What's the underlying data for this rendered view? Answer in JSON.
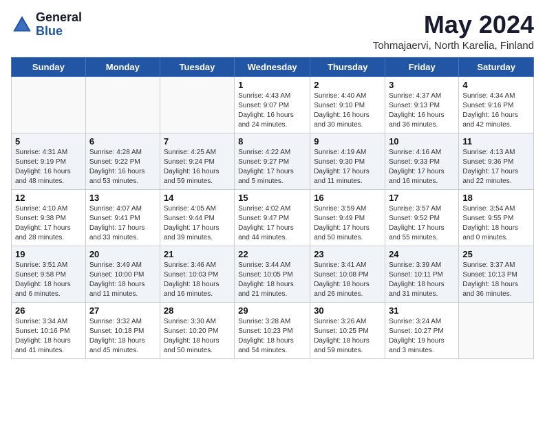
{
  "logo": {
    "general": "General",
    "blue": "Blue"
  },
  "title": "May 2024",
  "location": "Tohmajaervi, North Karelia, Finland",
  "days_of_week": [
    "Sunday",
    "Monday",
    "Tuesday",
    "Wednesday",
    "Thursday",
    "Friday",
    "Saturday"
  ],
  "weeks": [
    [
      {
        "day": "",
        "info": ""
      },
      {
        "day": "",
        "info": ""
      },
      {
        "day": "",
        "info": ""
      },
      {
        "day": "1",
        "info": "Sunrise: 4:43 AM\nSunset: 9:07 PM\nDaylight: 16 hours\nand 24 minutes."
      },
      {
        "day": "2",
        "info": "Sunrise: 4:40 AM\nSunset: 9:10 PM\nDaylight: 16 hours\nand 30 minutes."
      },
      {
        "day": "3",
        "info": "Sunrise: 4:37 AM\nSunset: 9:13 PM\nDaylight: 16 hours\nand 36 minutes."
      },
      {
        "day": "4",
        "info": "Sunrise: 4:34 AM\nSunset: 9:16 PM\nDaylight: 16 hours\nand 42 minutes."
      }
    ],
    [
      {
        "day": "5",
        "info": "Sunrise: 4:31 AM\nSunset: 9:19 PM\nDaylight: 16 hours\nand 48 minutes."
      },
      {
        "day": "6",
        "info": "Sunrise: 4:28 AM\nSunset: 9:22 PM\nDaylight: 16 hours\nand 53 minutes."
      },
      {
        "day": "7",
        "info": "Sunrise: 4:25 AM\nSunset: 9:24 PM\nDaylight: 16 hours\nand 59 minutes."
      },
      {
        "day": "8",
        "info": "Sunrise: 4:22 AM\nSunset: 9:27 PM\nDaylight: 17 hours\nand 5 minutes."
      },
      {
        "day": "9",
        "info": "Sunrise: 4:19 AM\nSunset: 9:30 PM\nDaylight: 17 hours\nand 11 minutes."
      },
      {
        "day": "10",
        "info": "Sunrise: 4:16 AM\nSunset: 9:33 PM\nDaylight: 17 hours\nand 16 minutes."
      },
      {
        "day": "11",
        "info": "Sunrise: 4:13 AM\nSunset: 9:36 PM\nDaylight: 17 hours\nand 22 minutes."
      }
    ],
    [
      {
        "day": "12",
        "info": "Sunrise: 4:10 AM\nSunset: 9:38 PM\nDaylight: 17 hours\nand 28 minutes."
      },
      {
        "day": "13",
        "info": "Sunrise: 4:07 AM\nSunset: 9:41 PM\nDaylight: 17 hours\nand 33 minutes."
      },
      {
        "day": "14",
        "info": "Sunrise: 4:05 AM\nSunset: 9:44 PM\nDaylight: 17 hours\nand 39 minutes."
      },
      {
        "day": "15",
        "info": "Sunrise: 4:02 AM\nSunset: 9:47 PM\nDaylight: 17 hours\nand 44 minutes."
      },
      {
        "day": "16",
        "info": "Sunrise: 3:59 AM\nSunset: 9:49 PM\nDaylight: 17 hours\nand 50 minutes."
      },
      {
        "day": "17",
        "info": "Sunrise: 3:57 AM\nSunset: 9:52 PM\nDaylight: 17 hours\nand 55 minutes."
      },
      {
        "day": "18",
        "info": "Sunrise: 3:54 AM\nSunset: 9:55 PM\nDaylight: 18 hours\nand 0 minutes."
      }
    ],
    [
      {
        "day": "19",
        "info": "Sunrise: 3:51 AM\nSunset: 9:58 PM\nDaylight: 18 hours\nand 6 minutes."
      },
      {
        "day": "20",
        "info": "Sunrise: 3:49 AM\nSunset: 10:00 PM\nDaylight: 18 hours\nand 11 minutes."
      },
      {
        "day": "21",
        "info": "Sunrise: 3:46 AM\nSunset: 10:03 PM\nDaylight: 18 hours\nand 16 minutes."
      },
      {
        "day": "22",
        "info": "Sunrise: 3:44 AM\nSunset: 10:05 PM\nDaylight: 18 hours\nand 21 minutes."
      },
      {
        "day": "23",
        "info": "Sunrise: 3:41 AM\nSunset: 10:08 PM\nDaylight: 18 hours\nand 26 minutes."
      },
      {
        "day": "24",
        "info": "Sunrise: 3:39 AM\nSunset: 10:11 PM\nDaylight: 18 hours\nand 31 minutes."
      },
      {
        "day": "25",
        "info": "Sunrise: 3:37 AM\nSunset: 10:13 PM\nDaylight: 18 hours\nand 36 minutes."
      }
    ],
    [
      {
        "day": "26",
        "info": "Sunrise: 3:34 AM\nSunset: 10:16 PM\nDaylight: 18 hours\nand 41 minutes."
      },
      {
        "day": "27",
        "info": "Sunrise: 3:32 AM\nSunset: 10:18 PM\nDaylight: 18 hours\nand 45 minutes."
      },
      {
        "day": "28",
        "info": "Sunrise: 3:30 AM\nSunset: 10:20 PM\nDaylight: 18 hours\nand 50 minutes."
      },
      {
        "day": "29",
        "info": "Sunrise: 3:28 AM\nSunset: 10:23 PM\nDaylight: 18 hours\nand 54 minutes."
      },
      {
        "day": "30",
        "info": "Sunrise: 3:26 AM\nSunset: 10:25 PM\nDaylight: 18 hours\nand 59 minutes."
      },
      {
        "day": "31",
        "info": "Sunrise: 3:24 AM\nSunset: 10:27 PM\nDaylight: 19 hours\nand 3 minutes."
      },
      {
        "day": "",
        "info": ""
      }
    ]
  ]
}
